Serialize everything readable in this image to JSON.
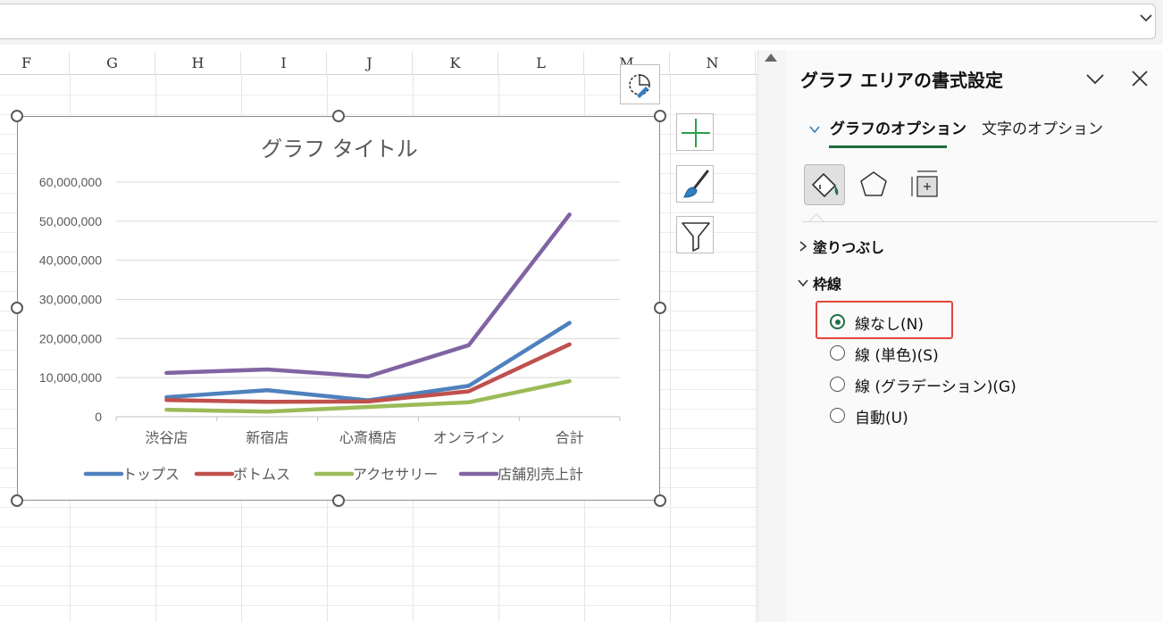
{
  "formula_bar": {
    "value": ""
  },
  "columns": [
    "F",
    "G",
    "H",
    "I",
    "J",
    "K",
    "L",
    "M",
    "N"
  ],
  "chart": {
    "title": "グラフ タイトル",
    "colors": {
      "トップス": "#4f81bd",
      "ボトムス": "#c0504d",
      "アクセサリー": "#9bbb59",
      "店舗別売上計": "#8064a2"
    },
    "chart_data": {
      "type": "line",
      "title": "グラフ タイトル",
      "categories": [
        "渋谷店",
        "新宿店",
        "心斎橋店",
        "オンライン",
        "合計"
      ],
      "series": [
        {
          "name": "トップス",
          "values": [
            5000000,
            6800000,
            4200000,
            7900000,
            24000000
          ]
        },
        {
          "name": "ボトムス",
          "values": [
            4300000,
            3800000,
            3900000,
            6500000,
            18500000
          ]
        },
        {
          "name": "アクセサリー",
          "values": [
            1800000,
            1300000,
            2500000,
            3700000,
            9100000
          ]
        },
        {
          "name": "店舗別売上計",
          "values": [
            11200000,
            12100000,
            10300000,
            18300000,
            51700000
          ]
        }
      ],
      "yticks": [
        "0",
        "10,000,000",
        "20,000,000",
        "30,000,000",
        "40,000,000",
        "50,000,000",
        "60,000,000"
      ],
      "ylim": [
        0,
        60000000
      ],
      "legend": "bottom",
      "grid": true
    }
  },
  "side_buttons": {
    "elements": "plus-icon",
    "styles": "brush-icon",
    "filters": "filter-icon"
  },
  "panel": {
    "title": "グラフ エリアの書式設定",
    "tabs": [
      {
        "label": "グラフのオプション",
        "active": true
      },
      {
        "label": "文字のオプション",
        "active": false
      }
    ],
    "sections": {
      "fill": "塗りつぶし",
      "border": "枠線"
    },
    "border_options": [
      {
        "label": "線なし(N)",
        "checked": true
      },
      {
        "label": "線 (単色)(S)",
        "checked": false
      },
      {
        "label": "線 (グラデーション)(G)",
        "checked": false
      },
      {
        "label": "自動(U)",
        "checked": false
      }
    ]
  }
}
